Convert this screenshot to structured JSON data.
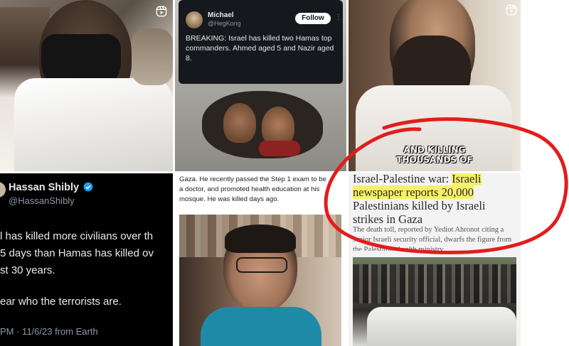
{
  "tile1": {
    "type": "reel-thumbnail",
    "icon": "reel-icon"
  },
  "tile2": {
    "author_name": "Michael",
    "author_handle": "@HegKong",
    "follow_label": "Follow",
    "tweet_text": "BREAKING: Israel has killed two Hamas top commanders. Ahmed aged 5 and Nazir aged 8."
  },
  "tile3": {
    "icon": "reel-icon",
    "caption_line1": "AND KILLING",
    "caption_line2": "THOUSANDS OF",
    "annotation_color": "#e11d1d"
  },
  "tile4": {
    "display_name": "Hassan Shibly",
    "handle": "@HassanShibly",
    "line1": "l has killed more civilians over th",
    "line2": "5 days than Hamas has killed ov",
    "line3": "st 30 years.",
    "line4": "ear who the terrorists are.",
    "timestamp": "PM · 11/6/23 from Earth",
    "verified_color": "#1d9bf0"
  },
  "tile5": {
    "caption_line1": "Gaza. He recently passed the Step 1 exam to be",
    "caption_line2": "a doctor, and promoted health education at his",
    "caption_line3": "mosque. He was killed days ago."
  },
  "tile6": {
    "headline_line1_plain": "Israel-Palestine war: ",
    "headline_line1_hl": "Israeli",
    "headline_line2_hl": "newspaper reports 20,000",
    "headline_line3": "Palestinians killed by Israeli",
    "headline_line4": "strikes in Gaza",
    "body_line1": "The death toll, reported by Yediot Ahronot citing a",
    "body_line2": "senior Israeli security official, dwarfs the figure from",
    "body_line3": "the Palestinian health ministry",
    "highlight_color": "#f7f06b"
  }
}
